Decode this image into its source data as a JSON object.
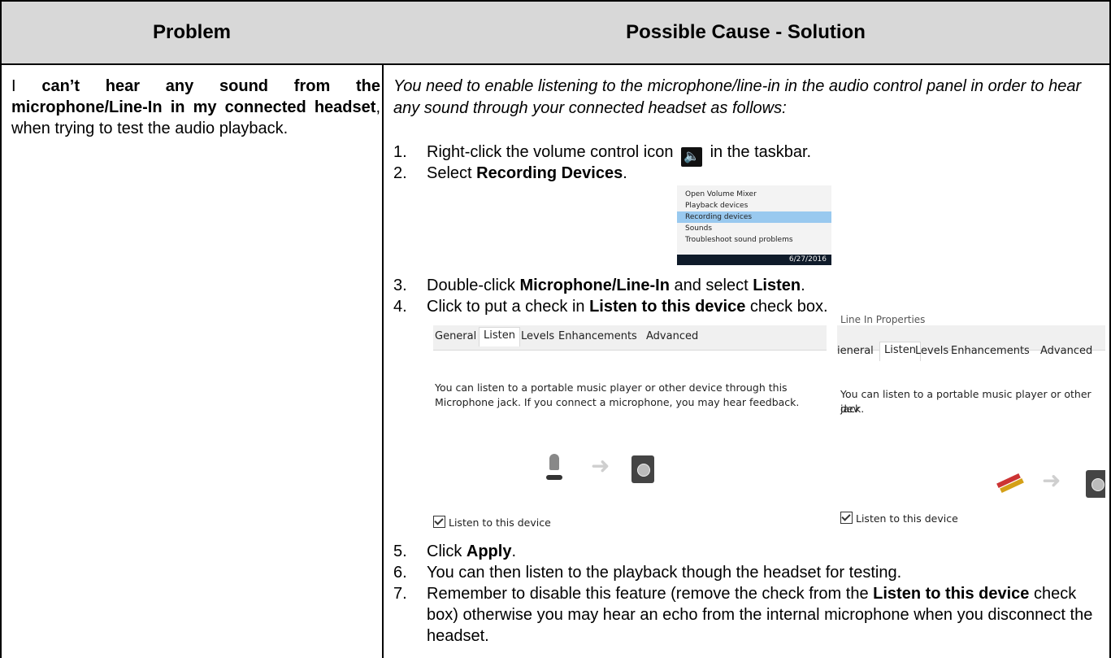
{
  "header": {
    "problem": "Problem",
    "solution": "Possible Cause - Solution"
  },
  "problem": {
    "p1": "I",
    "p2": "can’t hear any sound from the microphone/Line-In in my connected headset",
    "p3": ", when trying to test the audio playback."
  },
  "intro": "You need to enable listening to the microphone/line-in in the audio control panel in order to hear any sound through your connected headset as follows:",
  "steps": [
    {
      "num": "1.",
      "a": "Right-click the volume control icon",
      "b": "in the taskbar."
    },
    {
      "num": "2.",
      "a": "Select ",
      "bold": "Recording Devices",
      "b": "."
    },
    {
      "num": "3.",
      "a": "Double-click ",
      "bold": "Microphone/Line-In",
      "b": " and select ",
      "bold2": "Listen",
      "c": "."
    },
    {
      "num": "4.",
      "a": "Click to put a check in ",
      "bold": "Listen to this device",
      "b": " check box."
    },
    {
      "num": "5.",
      "a": "Click ",
      "bold": "Apply",
      "b": "."
    },
    {
      "num": "6.",
      "a": "You can then listen to the playback though the headset for testing."
    },
    {
      "num": "7.",
      "a": "Remember to disable this feature (remove the check from the ",
      "bold": "Listen to this device",
      "b": " check box) otherwise you may hear an echo from the internal microphone when you disconnect the headset."
    }
  ],
  "context_menu": {
    "items": [
      "Open Volume Mixer",
      "Playback devices",
      "Recording devices",
      "Sounds",
      "Troubleshoot sound problems"
    ],
    "selected_index": 2,
    "taskbar_date": "6/27/2016"
  },
  "dialog_left": {
    "tabs": [
      "General",
      "Listen",
      "Levels",
      "Enhancements",
      "Advanced"
    ],
    "active_tab": "Listen",
    "desc1": "You can listen to a portable music player or other device through this",
    "desc2": "Microphone jack.  If you connect a microphone, you may hear feedback.",
    "checkbox": "Listen to this device"
  },
  "dialog_right": {
    "title": "Line In Properties",
    "tabs": [
      "ieneral",
      "Listen",
      "Levels",
      "Enhancements",
      "Advanced"
    ],
    "active_tab": "Listen",
    "desc1": "You can listen to a portable music player or other dev",
    "desc2": "jack.",
    "checkbox": "Listen to this device"
  }
}
